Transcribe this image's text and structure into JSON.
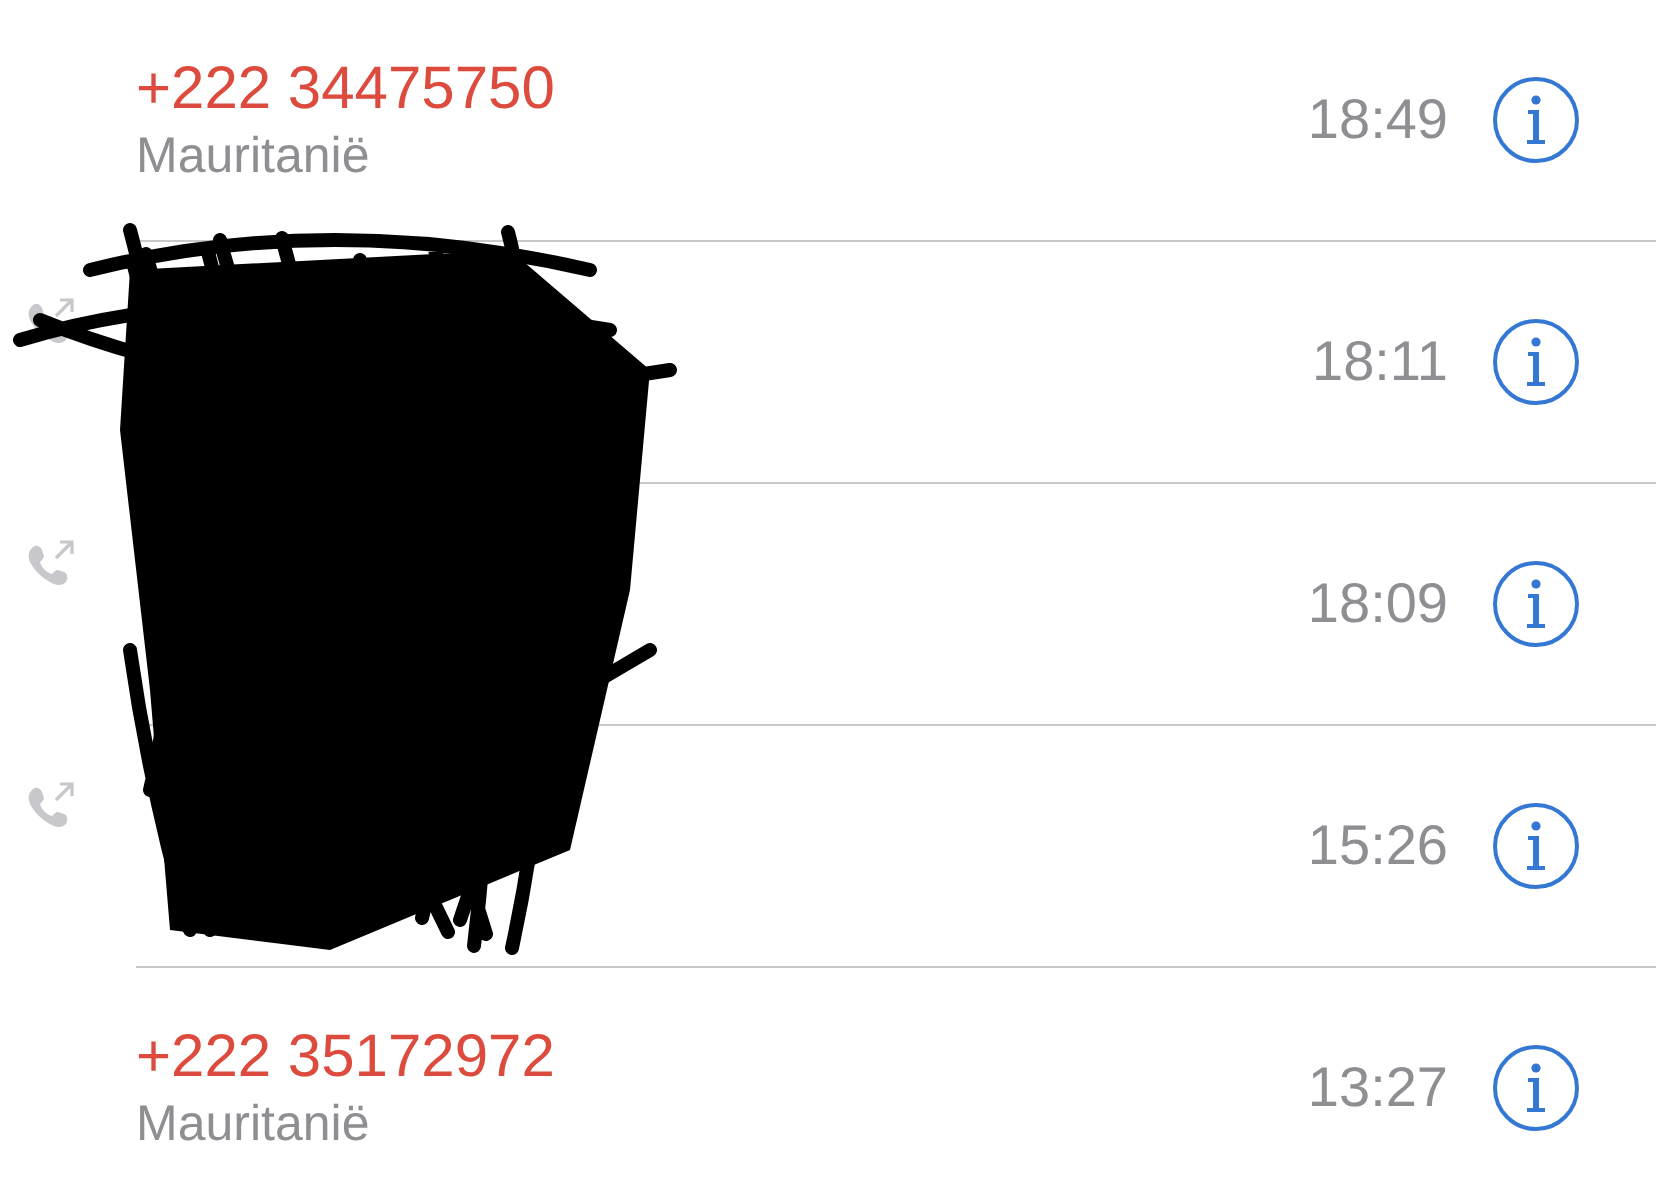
{
  "calls": [
    {
      "kind": "missed",
      "number": "+222 34475750",
      "place": "Mauritanië",
      "time": "18:49"
    },
    {
      "kind": "outgoing",
      "time": "18:11"
    },
    {
      "kind": "outgoing",
      "time": "18:09"
    },
    {
      "kind": "outgoing",
      "time": "15:26"
    },
    {
      "kind": "missed",
      "number": "+222 35172972",
      "place": "Mauritanië",
      "time": "13:27"
    }
  ]
}
